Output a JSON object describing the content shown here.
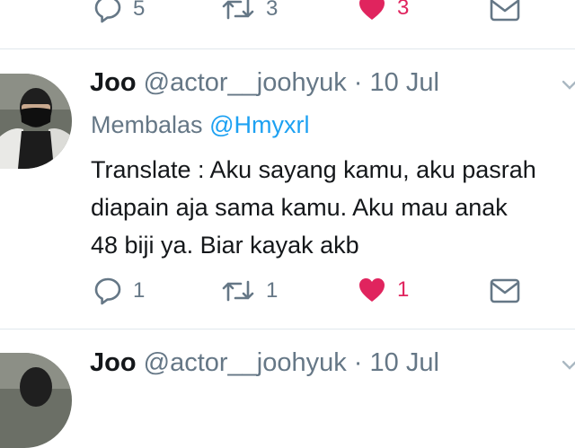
{
  "prev_tweet": {
    "reply_count": "5",
    "retweet_count": "3",
    "like_count": "3"
  },
  "tweet": {
    "display_name": "Joo",
    "handle": "@actor__joohyuk",
    "separator": " · ",
    "date": "10 Jul",
    "replying_prefix": "Membalas",
    "replying_to": "@Hmyxrl",
    "lines": [
      "Translate : Aku sayang kamu, aku pasrah",
      "diapain aja sama kamu. Aku mau anak",
      "48 biji ya. Biar kayak akb"
    ],
    "reply_count": "1",
    "retweet_count": "1",
    "like_count": "1"
  },
  "next_tweet": {
    "display_name": "Joo",
    "handle": "@actor__joohyuk",
    "separator": " · ",
    "date": "10 Jul"
  },
  "colors": {
    "like": "#e0245e",
    "mention": "#1da1f2",
    "secondary_text": "#657786",
    "divider": "#e1e8ed"
  },
  "icons": [
    "reply-icon",
    "retweet-icon",
    "heart-icon",
    "mail-icon",
    "chevron-down-icon"
  ]
}
